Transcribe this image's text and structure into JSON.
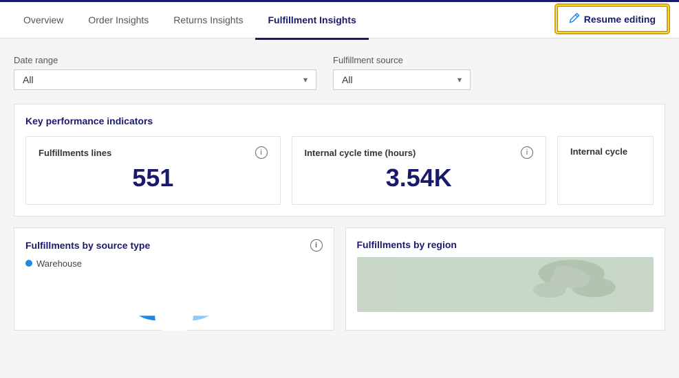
{
  "nav": {
    "tabs": [
      {
        "id": "overview",
        "label": "Overview",
        "active": false
      },
      {
        "id": "order-insights",
        "label": "Order Insights",
        "active": false
      },
      {
        "id": "returns-insights",
        "label": "Returns Insights",
        "active": false
      },
      {
        "id": "fulfillment-insights",
        "label": "Fulfillment Insights",
        "active": true
      }
    ],
    "resume_editing_label": "Resume editing"
  },
  "filters": {
    "date_range": {
      "label": "Date range",
      "value": "All",
      "placeholder": "All"
    },
    "fulfillment_source": {
      "label": "Fulfillment source",
      "value": "All",
      "placeholder": "All"
    }
  },
  "kpi_section": {
    "title": "Key performance indicators",
    "cards": [
      {
        "id": "fulfillment-lines",
        "title": "Fulfillments lines",
        "value": "551"
      },
      {
        "id": "internal-cycle-hours",
        "title": "Internal cycle time (hours)",
        "value": "3.54K"
      }
    ],
    "partial_card": {
      "title": "Internal cycle"
    }
  },
  "bottom_section": {
    "left_card": {
      "title": "Fulfillments by source type",
      "legend": [
        {
          "label": "Warehouse",
          "color": "#1e88e5"
        }
      ]
    },
    "right_card": {
      "title": "Fulfillments by region"
    }
  },
  "icons": {
    "info": "i",
    "chevron_down": "▾",
    "pencil": "✏"
  }
}
